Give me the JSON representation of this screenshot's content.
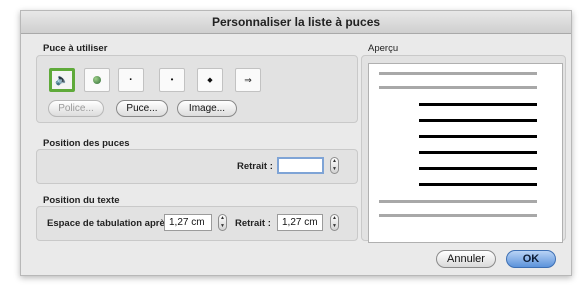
{
  "dialog": {
    "title": "Personnaliser la liste à puces"
  },
  "bullets_section": {
    "label": "Puce à utiliser",
    "bullets": [
      {
        "name": "speaker-bullet-icon",
        "glyph": "🔈",
        "selected": true
      },
      {
        "name": "green-ball-bullet-icon",
        "glyph": "",
        "selected": false
      },
      {
        "name": "small-dot-bullet-icon",
        "glyph": "·",
        "selected": false
      },
      {
        "name": "dot-bullet-icon",
        "glyph": "•",
        "selected": false
      },
      {
        "name": "diamond-bullet-icon",
        "glyph": "◆",
        "selected": false
      },
      {
        "name": "arrow-bullet-icon",
        "glyph": "⇒",
        "selected": false
      }
    ],
    "police_label": "Police...",
    "puce_label": "Puce...",
    "image_label": "Image..."
  },
  "bullet_position": {
    "label": "Position des puces",
    "retrait_label": "Retrait :",
    "retrait_value": ""
  },
  "text_position": {
    "label": "Position du texte",
    "tab_label": "Espace de tabulation après :",
    "tab_value": "1,27 cm",
    "retrait_label": "Retrait :",
    "retrait_value": "1,27 cm"
  },
  "preview": {
    "label": "Aperçu"
  },
  "buttons": {
    "cancel": "Annuler",
    "ok": "OK"
  },
  "colors": {
    "selection": "#5faa3a",
    "ok_button": "#5c93db",
    "preview_line": "#000000",
    "preview_gray": "#a8a8a8"
  }
}
